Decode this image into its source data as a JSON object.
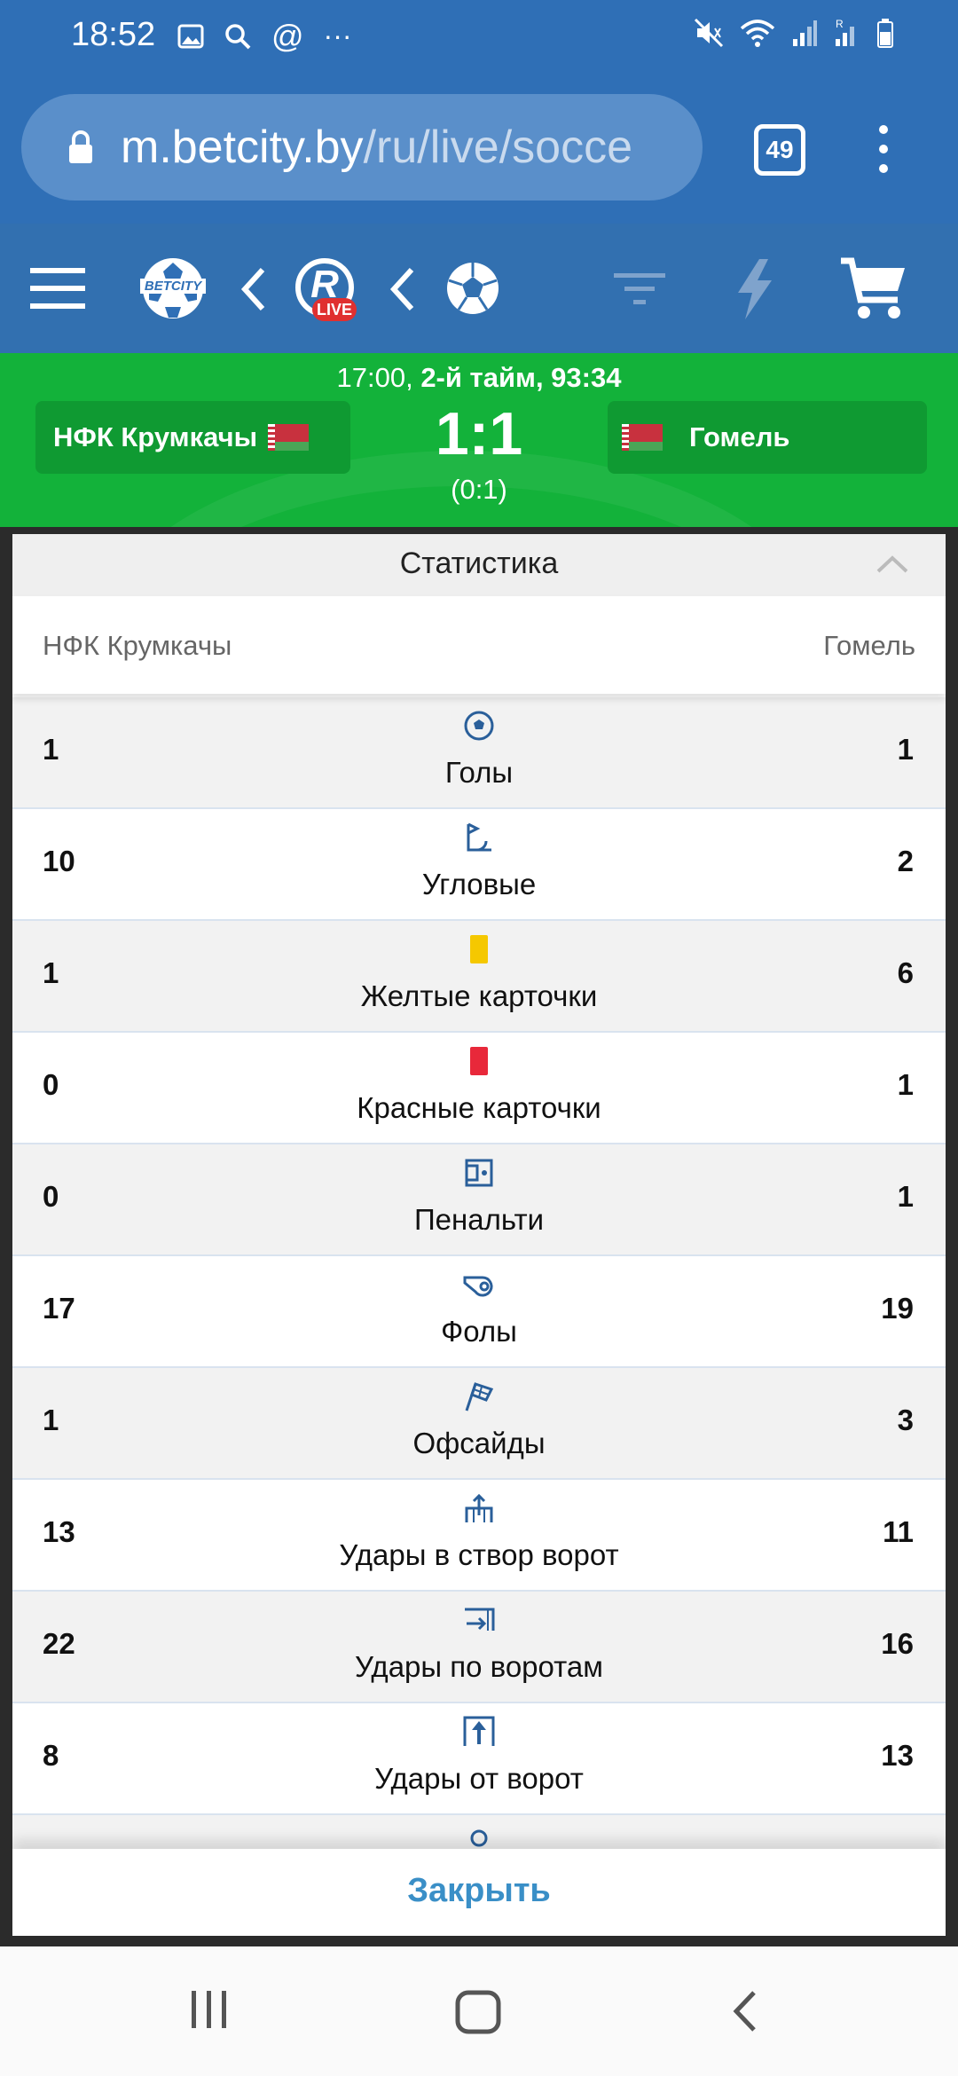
{
  "status_bar": {
    "time": "18:52",
    "more": "···"
  },
  "browser": {
    "url_host": "m.betcity.by",
    "url_path": "/ru/live/socce",
    "tab_count": "49"
  },
  "site_nav": {
    "brand": "BETCITY",
    "live_badge": "LIVE",
    "live_letter": "R"
  },
  "match": {
    "time_prefix": "17:00, ",
    "period": "2-й тайм, 93:34",
    "team_home": "НФК Крумкачы",
    "team_away": "Гомель",
    "score": "1:1",
    "half_score": "(0:1)"
  },
  "stats": {
    "title": "Статистика",
    "home": "НФК Крумкачы",
    "away": "Гомель",
    "rows": [
      {
        "label": "Голы",
        "home": "1",
        "away": "1",
        "icon": "ball-icon"
      },
      {
        "label": "Угловые",
        "home": "10",
        "away": "2",
        "icon": "corner-flag-icon"
      },
      {
        "label": "Желтые карточки",
        "home": "1",
        "away": "6",
        "icon": "yellow-card-icon"
      },
      {
        "label": "Красные карточки",
        "home": "0",
        "away": "1",
        "icon": "red-card-icon"
      },
      {
        "label": "Пенальти",
        "home": "0",
        "away": "1",
        "icon": "penalty-spot-icon"
      },
      {
        "label": "Фолы",
        "home": "17",
        "away": "19",
        "icon": "whistle-icon"
      },
      {
        "label": "Офсайды",
        "home": "1",
        "away": "3",
        "icon": "offside-flag-icon"
      },
      {
        "label": "Удары в створ ворот",
        "home": "13",
        "away": "11",
        "icon": "shot-on-target-icon"
      },
      {
        "label": "Удары по воротам",
        "home": "22",
        "away": "16",
        "icon": "shot-icon"
      },
      {
        "label": "Удары от ворот",
        "home": "8",
        "away": "13",
        "icon": "goal-kick-icon"
      }
    ],
    "close_label": "Закрыть"
  },
  "colors": {
    "browser_blue": "#2f6fb6",
    "nav_blue": "#3270b0",
    "match_green": "#13b23a",
    "yellow_card": "#f5c800",
    "red_card": "#e8283a",
    "icon_blue": "#2a5f9a",
    "close_blue": "#3a8fc7"
  }
}
